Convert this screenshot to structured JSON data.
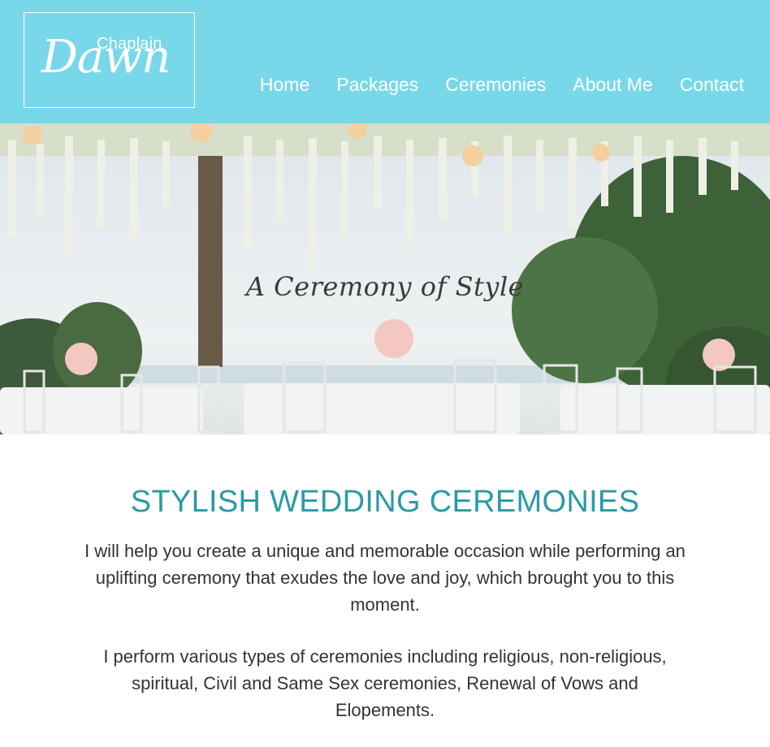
{
  "logo": {
    "small_text": "Chaplain",
    "big_text": "Dawn"
  },
  "nav": {
    "items": [
      "Home",
      "Packages",
      "Ceremonies",
      "About Me",
      "Contact"
    ]
  },
  "hero": {
    "caption": "A Ceremony of Style"
  },
  "main": {
    "headline": "STYLISH WEDDING CEREMONIES",
    "paragraph1": "I will help you create a unique and memorable occasion while performing an uplifting ceremony that exudes the love and joy, which brought you to this moment.",
    "paragraph2": "I perform various types of ceremonies including religious, non-religious, spiritual, Civil and Same Sex ceremonies, Renewal of Vows and Elopements."
  },
  "colors": {
    "header_bg": "#78d8ea",
    "headline": "#2a9aa7",
    "body_text": "#333333"
  }
}
